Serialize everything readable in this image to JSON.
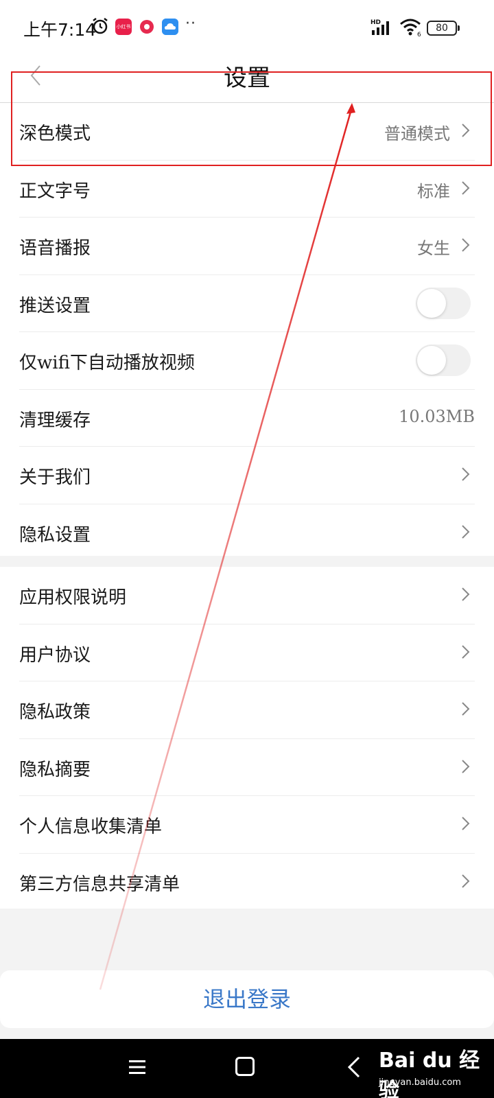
{
  "status_bar": {
    "time": "上午7:14",
    "app_badge_text": "小红书",
    "dots": "··",
    "network": "HD",
    "wifi_badge": "6",
    "battery": "80"
  },
  "header": {
    "title": "设置"
  },
  "settings_group1": [
    {
      "label": "深色模式",
      "value": "普通模式",
      "control": "chevron"
    },
    {
      "label": "正文字号",
      "value": "标准",
      "control": "chevron"
    },
    {
      "label": "语音播报",
      "value": "女生",
      "control": "chevron"
    },
    {
      "label": "推送设置",
      "value": "",
      "control": "toggle",
      "toggle_on": false
    },
    {
      "label": "仅wifi下自动播放视频",
      "value": "",
      "control": "toggle",
      "toggle_on": false
    },
    {
      "label": "清理缓存",
      "value": "10.03MB",
      "control": "none"
    },
    {
      "label": "关于我们",
      "value": "",
      "control": "chevron"
    },
    {
      "label": "隐私设置",
      "value": "",
      "control": "chevron"
    }
  ],
  "settings_group2": [
    {
      "label": "应用权限说明",
      "control": "chevron"
    },
    {
      "label": "用户协议",
      "control": "chevron"
    },
    {
      "label": "隐私政策",
      "control": "chevron"
    },
    {
      "label": "隐私摘要",
      "control": "chevron"
    },
    {
      "label": "个人信息收集清单",
      "control": "chevron"
    },
    {
      "label": "第三方信息共享清单",
      "control": "chevron"
    }
  ],
  "logout": {
    "label": "退出登录"
  },
  "watermark": {
    "brand": "Bai du 经验",
    "url": "jingyan.baidu.com"
  },
  "colors": {
    "accent_blue": "#3a78c8",
    "annotation_red": "#e02020",
    "divider": "#ececec"
  }
}
